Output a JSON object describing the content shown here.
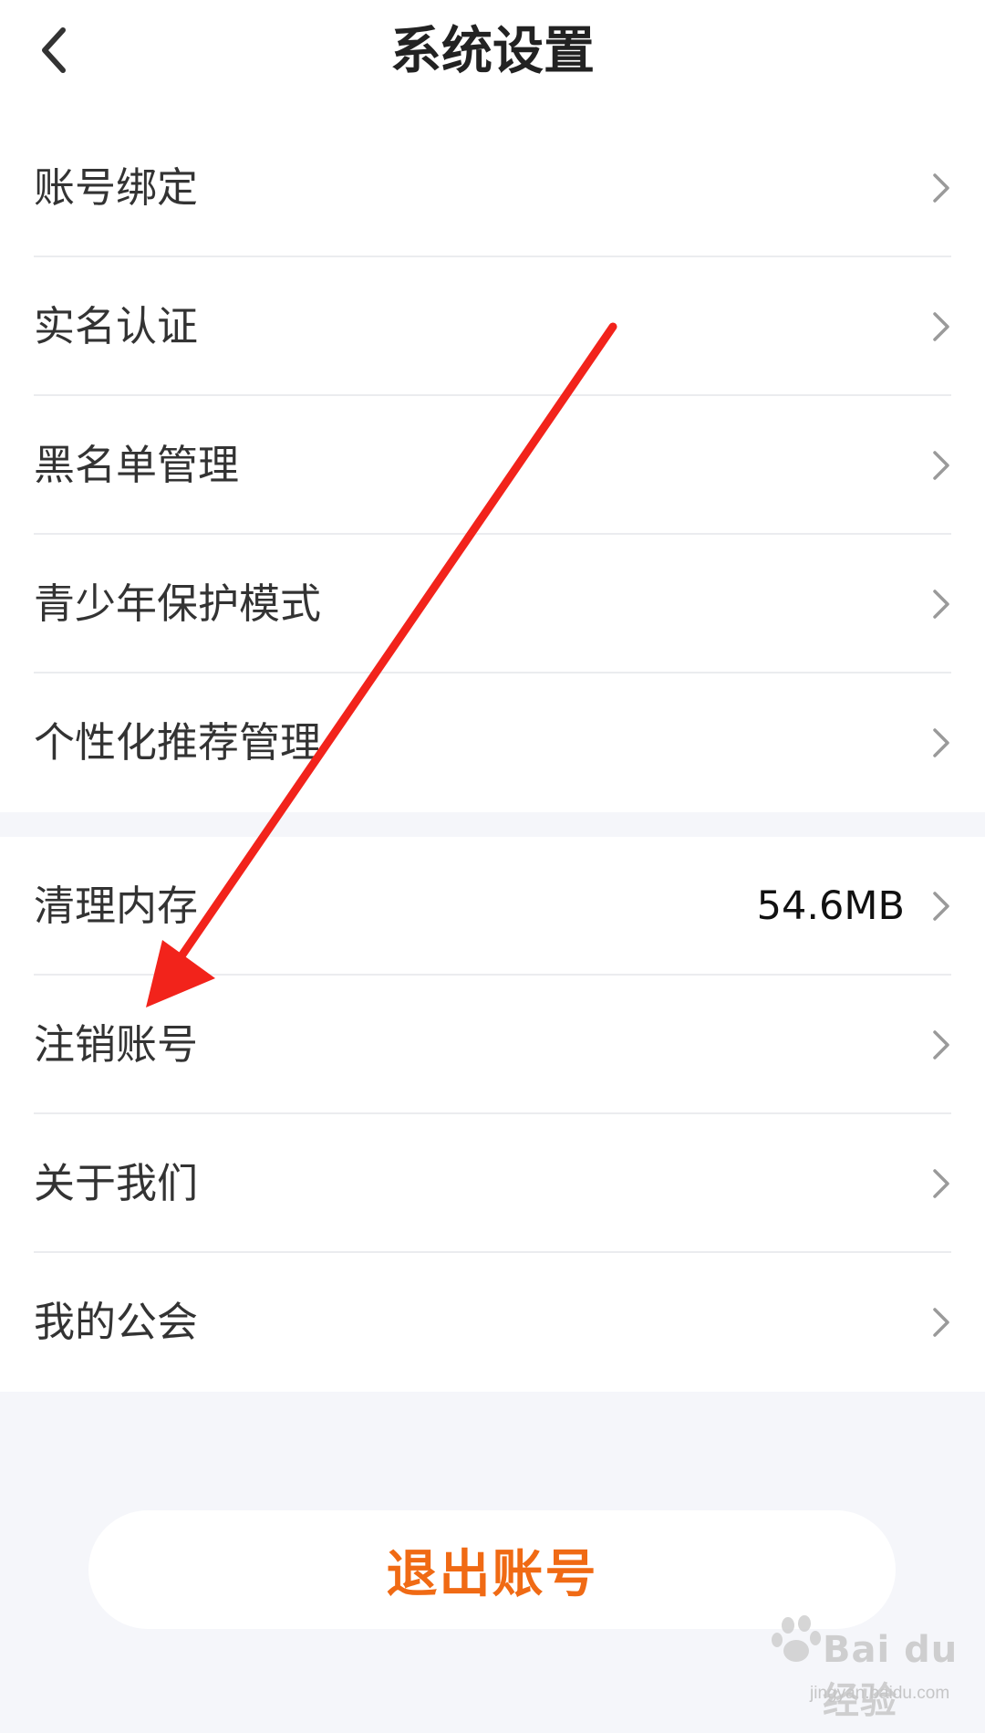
{
  "header": {
    "title": "系统设置",
    "back_icon": "chevron-left-icon"
  },
  "settings_group_1": {
    "items": [
      {
        "label": "账号绑定"
      },
      {
        "label": "实名认证"
      },
      {
        "label": "黑名单管理"
      },
      {
        "label": "青少年保护模式"
      },
      {
        "label": "个性化推荐管理"
      }
    ]
  },
  "settings_group_2": {
    "items": [
      {
        "label": "清理内存",
        "value": "54.6MB"
      },
      {
        "label": "注销账号"
      },
      {
        "label": "关于我们"
      },
      {
        "label": "我的公会"
      }
    ]
  },
  "logout": {
    "label": "退出账号",
    "color": "#f06a14"
  },
  "annotation": {
    "color": "#f2231b",
    "points_to": "注销账号"
  },
  "watermark": {
    "brand": "Bai du 经验",
    "url": "jingyan.baidu.com"
  }
}
